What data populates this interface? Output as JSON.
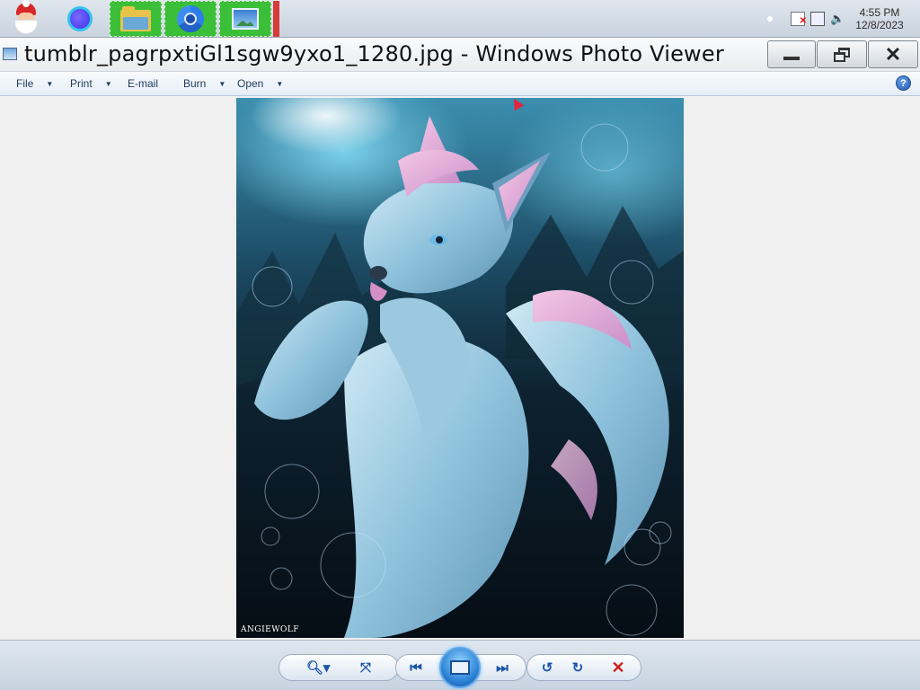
{
  "taskbar": {
    "pinned": [
      {
        "name": "santa-app-icon"
      },
      {
        "name": "orb-app-icon"
      },
      {
        "name": "file-explorer-icon"
      },
      {
        "name": "chrome-icon"
      },
      {
        "name": "photo-viewer-icon"
      }
    ],
    "tray": {
      "time": "4:55 PM",
      "date": "12/8/2023",
      "icons": [
        "action-center-flag-icon",
        "network-icon",
        "volume-icon"
      ]
    }
  },
  "window": {
    "title": "tumblr_pagrpxtiGl1sgw9yxo1_1280.jpg - Windows Photo Viewer",
    "buttons": {
      "minimize": "minimize-icon",
      "maximize": "restore-icon",
      "close": "close-icon"
    }
  },
  "menu": {
    "file": "File",
    "print": "Print",
    "email": "E-mail",
    "burn": "Burn",
    "open": "Open",
    "help": "?"
  },
  "image": {
    "signature": "ANGIEWOLF"
  },
  "controls": {
    "zoom": "zoom-icon",
    "fit": "actual-size-icon",
    "prev": "previous-icon",
    "slideshow": "slideshow-icon",
    "next": "next-icon",
    "rotate_ccw": "rotate-counterclockwise-icon",
    "rotate_cw": "rotate-clockwise-icon",
    "delete": "delete-icon"
  },
  "colors": {
    "accent_green": "#3cbf38",
    "delete_red": "#cc2020",
    "control_blue": "#1c55a8"
  }
}
